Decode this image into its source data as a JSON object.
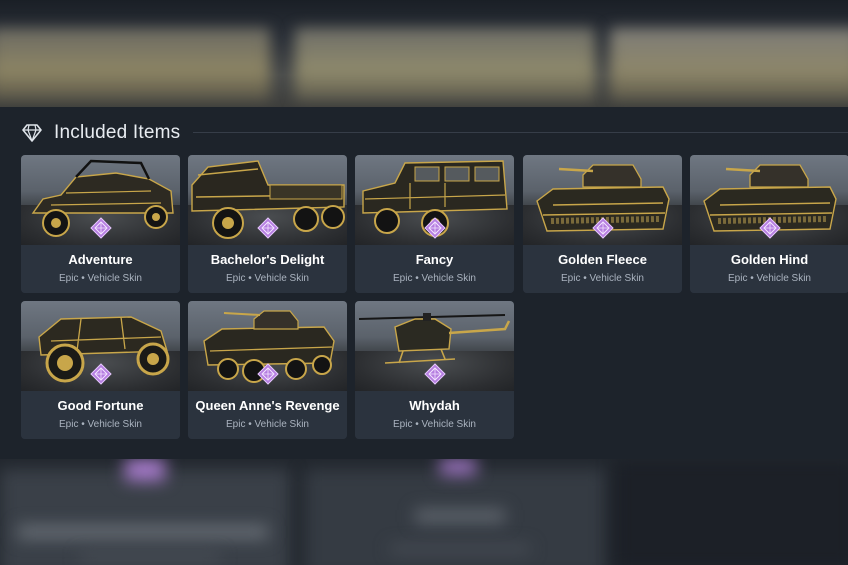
{
  "section": {
    "title": "Included Items",
    "icon": "diamond-icon"
  },
  "rarity_icon": "epic-rarity-icon",
  "colors": {
    "epic": "#b57de0",
    "gold": "#c8a64a"
  },
  "items": [
    {
      "name": "Adventure",
      "subtitle": "Epic • Vehicle Skin",
      "vehicle": "buggy"
    },
    {
      "name": "Bachelor's Delight",
      "subtitle": "Epic • Vehicle Skin",
      "vehicle": "truck"
    },
    {
      "name": "Fancy",
      "subtitle": "Epic • Vehicle Skin",
      "vehicle": "suv"
    },
    {
      "name": "Golden Fleece",
      "subtitle": "Epic • Vehicle Skin",
      "vehicle": "tank"
    },
    {
      "name": "Golden Hind",
      "subtitle": "Epic • Vehicle Skin",
      "vehicle": "tank"
    },
    {
      "name": "Good Fortune",
      "subtitle": "Epic • Vehicle Skin",
      "vehicle": "atv"
    },
    {
      "name": "Queen Anne's Revenge",
      "subtitle": "Epic • Vehicle Skin",
      "vehicle": "apc"
    },
    {
      "name": "Whydah",
      "subtitle": "Epic • Vehicle Skin",
      "vehicle": "helicopter"
    }
  ]
}
